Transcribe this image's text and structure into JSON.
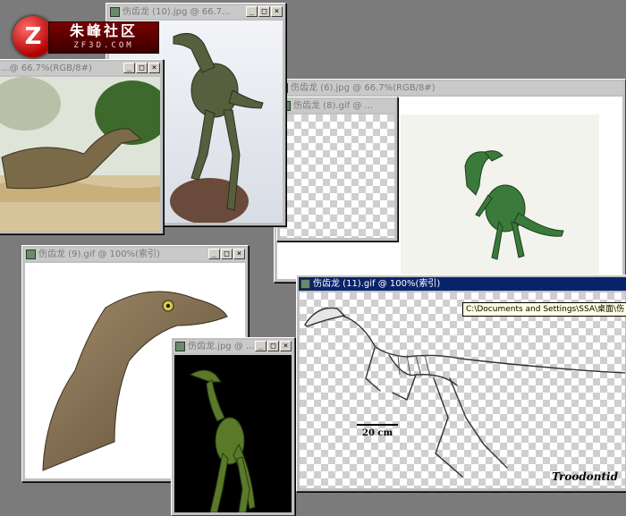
{
  "logo": {
    "text_main": "朱峰社区",
    "text_sub": "ZF3D.COM",
    "mark": "Z"
  },
  "windows": {
    "w10": {
      "title": "伤齿龙 (10).jpg @ 66.7..."
    },
    "wleft": {
      "title": "...@ 66.7%(RGB/8#)"
    },
    "w6": {
      "title": "伤齿龙 (6).jpg @ 66.7%(RGB/8#)"
    },
    "w8": {
      "title": "伤齿龙 (8).gif @ ..."
    },
    "w9": {
      "title": "伤齿龙 (9).gif @ 100%(索引)"
    },
    "wsmall": {
      "title": "伤齿龙.jpg @ ..."
    },
    "w11": {
      "title": "伤齿龙 (11).gif @ 100%(索引)",
      "scale_label": "20 cm",
      "caption": "Troodontid"
    }
  },
  "window_controls": {
    "minimize": "_",
    "maximize": "□",
    "close": "×"
  },
  "tooltip": {
    "text": "C:\\Documents and Settings\\SSA\\桌面\\伤"
  }
}
